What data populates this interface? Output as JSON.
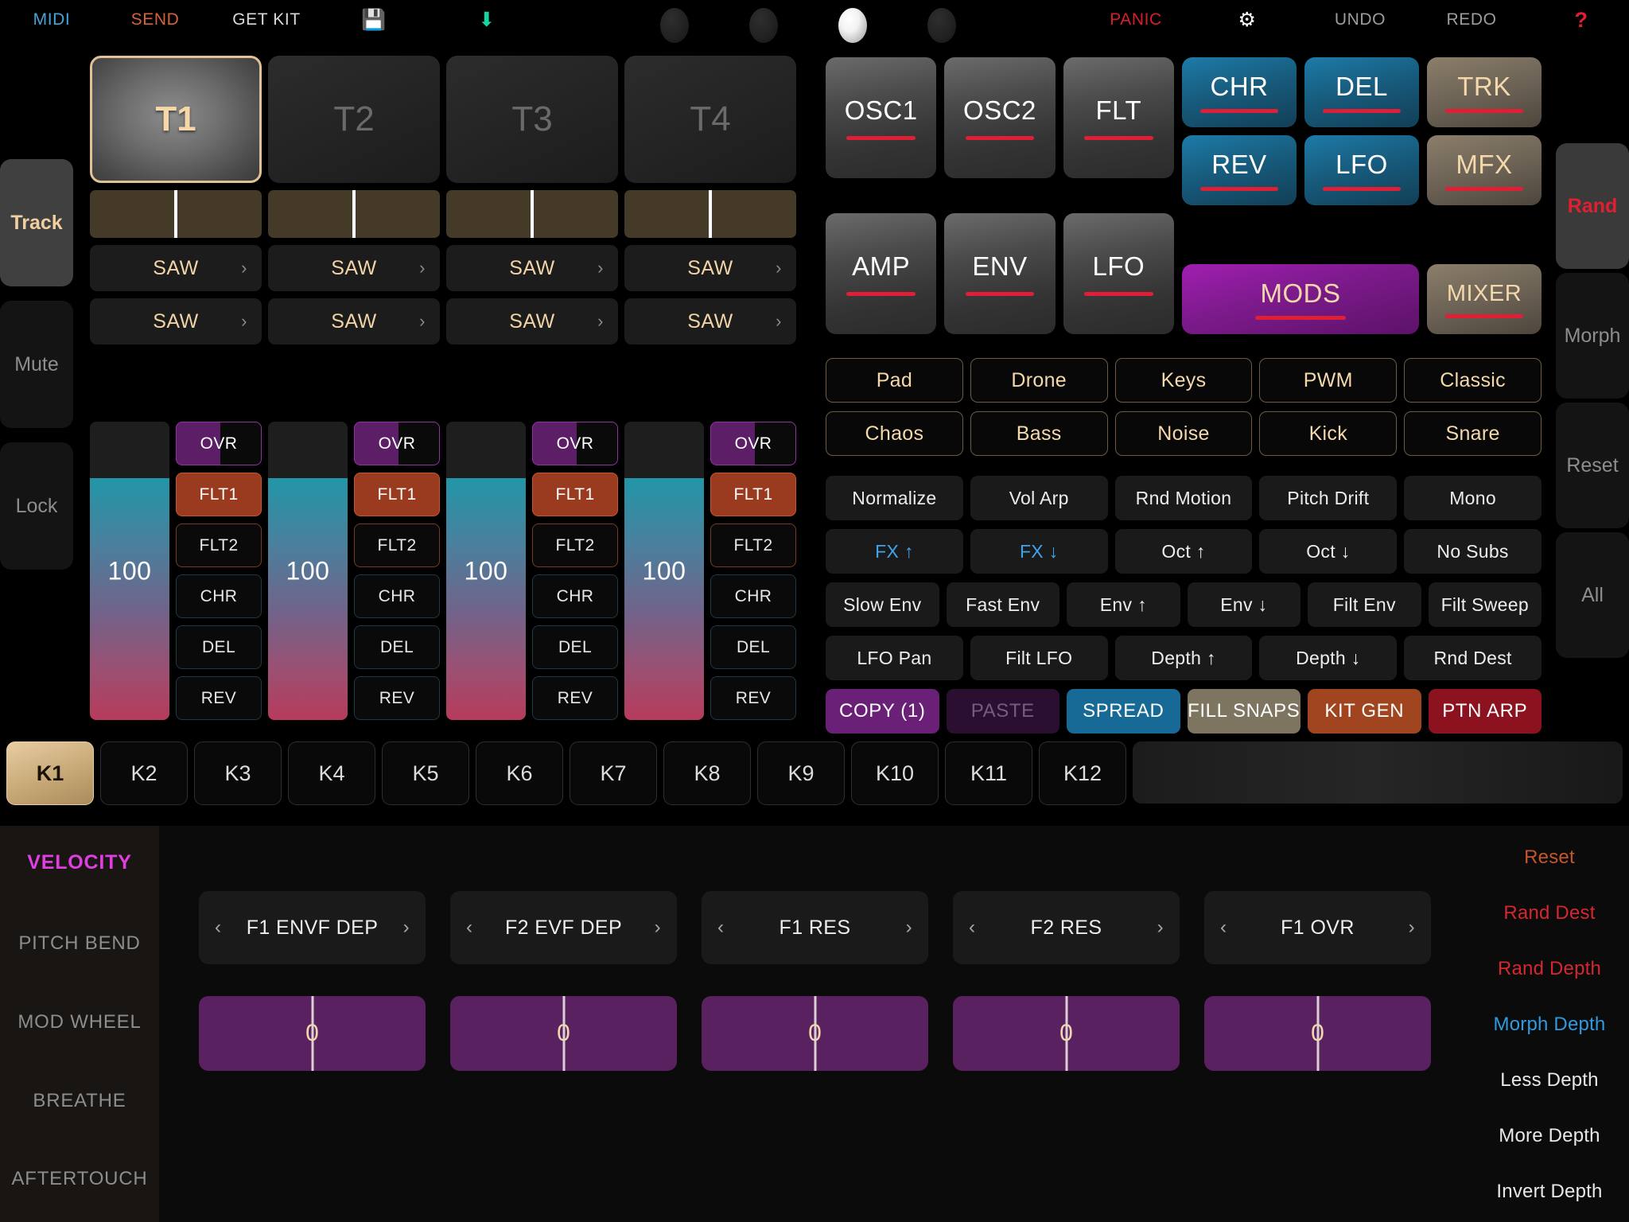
{
  "topbar": {
    "midi": "MIDI",
    "send": "SEND",
    "get_kit": "GET KIT",
    "save_icon": "floppy-disk-icon",
    "load_icon": "download-icon",
    "panic": "PANIC",
    "gear_icon": "gear-icon",
    "undo": "UNDO",
    "redo": "REDO",
    "help": "?",
    "lamps": [
      false,
      false,
      true,
      false
    ]
  },
  "mode_rail": [
    {
      "label": "Track",
      "active": true
    },
    {
      "label": "Mute",
      "active": false
    },
    {
      "label": "Lock",
      "active": false
    }
  ],
  "tracks": [
    {
      "pad": "T1",
      "active": true,
      "osc1": "SAW",
      "osc2": "SAW",
      "level": "100",
      "level_pct": 81
    },
    {
      "pad": "T2",
      "active": false,
      "osc1": "SAW",
      "osc2": "SAW",
      "level": "100",
      "level_pct": 81
    },
    {
      "pad": "T3",
      "active": false,
      "osc1": "SAW",
      "osc2": "SAW",
      "level": "100",
      "level_pct": 81
    },
    {
      "pad": "T4",
      "active": false,
      "osc1": "SAW",
      "osc2": "SAW",
      "level": "100",
      "level_pct": 81
    }
  ],
  "fx_chain": [
    {
      "label": "OVR",
      "state": "half"
    },
    {
      "label": "FLT1",
      "state": "on"
    },
    {
      "label": "FLT2",
      "state": "off-warm"
    },
    {
      "label": "CHR",
      "state": "off"
    },
    {
      "label": "DEL",
      "state": "off"
    },
    {
      "label": "REV",
      "state": "off"
    }
  ],
  "modules": {
    "grey": [
      "OSC1",
      "OSC2",
      "FLT",
      "AMP",
      "ENV",
      "LFO"
    ],
    "blue": [
      "CHR",
      "DEL",
      "REV",
      "LFO"
    ],
    "tan": [
      "TRK",
      "MFX"
    ],
    "mods": "MODS",
    "mixer": "MIXER"
  },
  "presets": {
    "row1": [
      "Pad",
      "Drone",
      "Keys",
      "PWM",
      "Classic"
    ],
    "row2": [
      "Chaos",
      "Bass",
      "Noise",
      "Kick",
      "Snare"
    ],
    "row3": [
      "Normalize",
      "Vol Arp",
      "Rnd Motion",
      "Pitch Drift",
      "Mono"
    ],
    "row4": [
      "FX ↑",
      "FX ↓",
      "Oct ↑",
      "Oct ↓",
      "No Subs"
    ],
    "row5": [
      "Slow Env",
      "Fast Env",
      "Env ↑",
      "Env ↓",
      "Filt Env",
      "Filt Sweep"
    ],
    "row6": [
      "LFO Pan",
      "Filt LFO",
      "Depth ↑",
      "Depth ↓",
      "Rnd Dest"
    ],
    "actions": [
      "COPY (1)",
      "PASTE",
      "SPREAD",
      "FILL SNAPS",
      "KIT GEN",
      "PTN ARP"
    ]
  },
  "side_rail": [
    {
      "label": "Rand",
      "active": true
    },
    {
      "label": "Morph",
      "active": false
    },
    {
      "label": "Reset",
      "active": false
    },
    {
      "label": "All",
      "active": false
    }
  ],
  "k_slots": {
    "labels": [
      "K1",
      "K2",
      "K3",
      "K4",
      "K5",
      "K6",
      "K7",
      "K8",
      "K9",
      "K10",
      "K11",
      "K12"
    ],
    "active_index": 0
  },
  "mod_sources": [
    {
      "label": "VELOCITY",
      "selected": true
    },
    {
      "label": "PITCH BEND",
      "selected": false
    },
    {
      "label": "MOD WHEEL",
      "selected": false
    },
    {
      "label": "BREATHE",
      "selected": false
    },
    {
      "label": "AFTERTOUCH",
      "selected": false
    }
  ],
  "mod_params": [
    {
      "dest": "F1 ENVF DEP",
      "value": "0"
    },
    {
      "dest": "F2 EVF DEP",
      "value": "0"
    },
    {
      "dest": "F1 RES",
      "value": "0"
    },
    {
      "dest": "F2 RES",
      "value": "0"
    },
    {
      "dest": "F1 OVR",
      "value": "0"
    }
  ],
  "mod_actions": [
    {
      "label": "Reset",
      "color": "#c4562c"
    },
    {
      "label": "Rand Dest",
      "color": "#d6272f"
    },
    {
      "label": "Rand Depth",
      "color": "#d6272f"
    },
    {
      "label": "Morph Depth",
      "color": "#2f9ae0"
    },
    {
      "label": "Less Depth",
      "color": "#e8e8e8"
    },
    {
      "label": "More Depth",
      "color": "#e8e8e8"
    },
    {
      "label": "Invert Depth",
      "color": "#e8e8e8"
    }
  ],
  "colors": {
    "accent_gold": "#f0d4a6",
    "accent_red": "#e02030",
    "accent_magenta": "#e13ee1",
    "accent_blue": "#3fa4ef",
    "slider_purple": "#5a2160"
  }
}
